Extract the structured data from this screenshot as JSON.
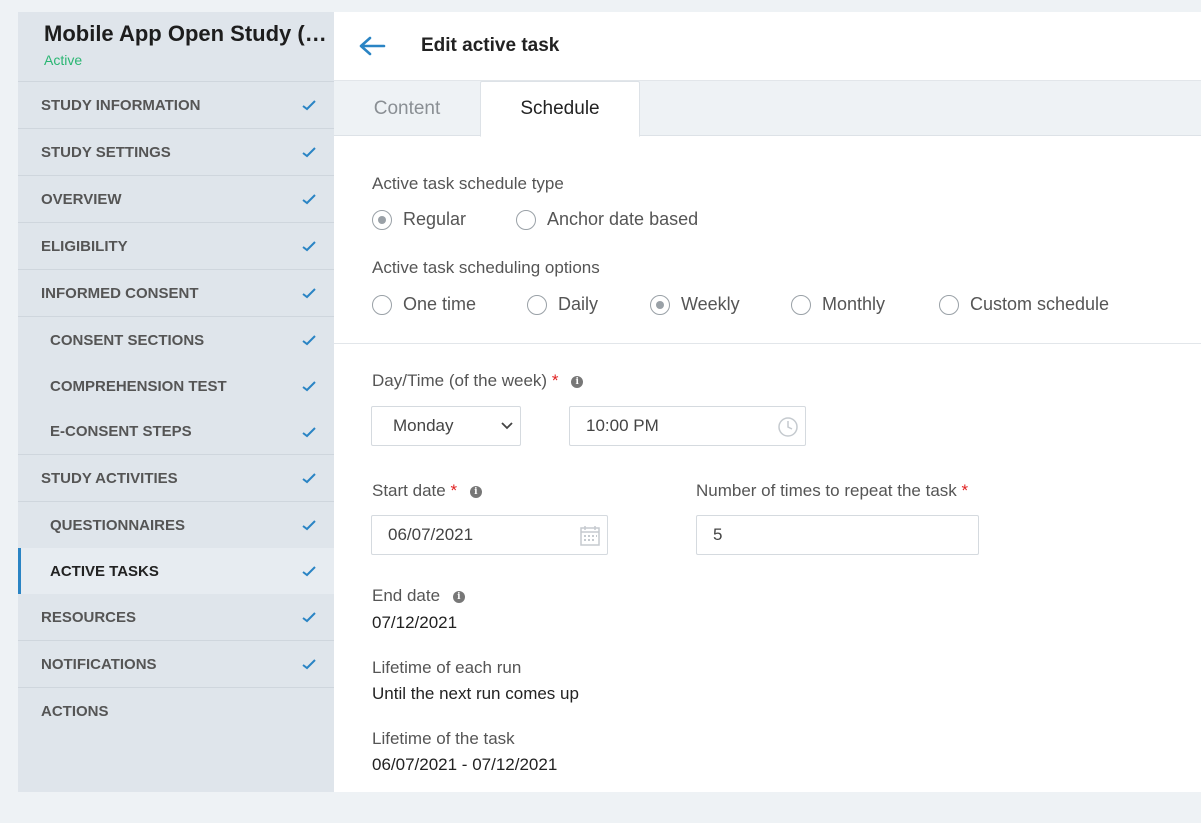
{
  "sidebar": {
    "title": "Mobile App Open Study (O...",
    "status": "Active",
    "items": [
      {
        "label": "STUDY INFORMATION",
        "checked": true
      },
      {
        "label": "STUDY SETTINGS",
        "checked": true
      },
      {
        "label": "OVERVIEW",
        "checked": true
      },
      {
        "label": "ELIGIBILITY",
        "checked": true
      },
      {
        "label": "INFORMED CONSENT",
        "checked": true
      },
      {
        "label": "CONSENT SECTIONS",
        "checked": true
      },
      {
        "label": "COMPREHENSION TEST",
        "checked": true
      },
      {
        "label": "E-CONSENT STEPS",
        "checked": true
      },
      {
        "label": "STUDY ACTIVITIES",
        "checked": true
      },
      {
        "label": "QUESTIONNAIRES",
        "checked": true
      },
      {
        "label": "ACTIVE TASKS",
        "checked": true
      },
      {
        "label": "RESOURCES",
        "checked": true
      },
      {
        "label": "NOTIFICATIONS",
        "checked": true
      },
      {
        "label": "ACTIONS",
        "checked": false
      }
    ]
  },
  "header": {
    "title": "Edit active task"
  },
  "tabs": [
    {
      "label": "Content"
    },
    {
      "label": "Schedule"
    }
  ],
  "form": {
    "schedule_type_label": "Active task schedule type",
    "schedule_types": [
      "Regular",
      "Anchor date based"
    ],
    "options_label": "Active task scheduling options",
    "options": [
      "One time",
      "Daily",
      "Weekly",
      "Monthly",
      "Custom schedule"
    ],
    "daytime_label": "Day/Time (of the week)",
    "required_mark": "*",
    "day_value": "Monday",
    "time_value": "10:00 PM",
    "start_date_label": "Start date",
    "start_date_value": "06/07/2021",
    "repeat_label": "Number of times to repeat the task",
    "repeat_value": "5",
    "end_date_label": "End date",
    "end_date_value": "07/12/2021",
    "lifetime_run_label": "Lifetime of each run",
    "lifetime_run_value": "Until the next run comes up",
    "lifetime_task_label": "Lifetime of the task",
    "lifetime_task_value": "06/07/2021 - 07/12/2021",
    "info_glyph": "i"
  },
  "colors": {
    "accent": "#2a84c4",
    "active_status": "#2bb673",
    "required": "#e02020"
  }
}
